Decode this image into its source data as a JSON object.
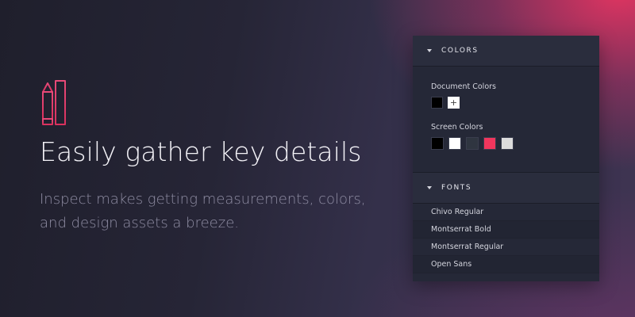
{
  "hero": {
    "icon": "pencil-ruler-icon",
    "title": "Easily gather key details",
    "subtitle": "Inspect makes getting measurements, colors, and design assets a breeze."
  },
  "panel": {
    "colors": {
      "header": "COLORS",
      "document_label": "Document Colors",
      "document_colors": [
        "#000000"
      ],
      "add_symbol": "+",
      "screen_label": "Screen Colors",
      "screen_colors": [
        "#000000",
        "#ffffff",
        "#2f3540",
        "#f0365d",
        "#dcdcdc"
      ]
    },
    "fonts": {
      "header": "FONTS",
      "items": [
        "Chivo Regular",
        "Montserrat Bold",
        "Montserrat Regular",
        "Open Sans"
      ]
    }
  },
  "colors": {
    "accent": "#e83a64",
    "panel_bg": "#252837"
  }
}
